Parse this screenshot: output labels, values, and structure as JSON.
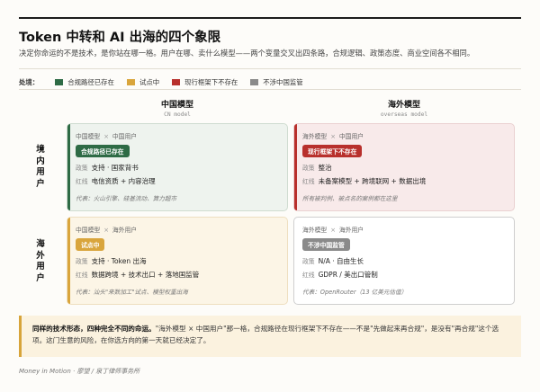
{
  "header": {
    "title": "Token 中转和 AI 出海的四个象限",
    "subtitle": "决定你命运的不是技术，是你站在哪一格。用户在哪、卖什么模型——两个变量交叉出四条路，合规逻辑、政策态度、商业空间各不相同。"
  },
  "legend": {
    "title": "处境：",
    "items": [
      {
        "label": "合规路径已存在",
        "color": "#2e6b45"
      },
      {
        "label": "试点中",
        "color": "#d9a53c"
      },
      {
        "label": "现行框架下不存在",
        "color": "#b8302c"
      },
      {
        "label": "不涉中国监管",
        "color": "#8a8a8a"
      }
    ]
  },
  "columns": [
    {
      "cn": "中国模型",
      "en": "CN model"
    },
    {
      "cn": "海外模型",
      "en": "overseas model"
    }
  ],
  "rows": [
    {
      "label": "境内用户"
    },
    {
      "label": "海外用户"
    }
  ],
  "quadrants": {
    "q1": {
      "model": "中国模型",
      "x": "×",
      "user": "中国用户",
      "badge": "合规路径已存在",
      "badge_color": "#2e6b45",
      "policy_key": "政策",
      "policy": "支持 · 国家背书",
      "red_key": "红线",
      "red": "电信资质 + 内容治理",
      "note": "代表：火山引擎、硅基流动、算力超市"
    },
    "q2": {
      "model": "海外模型",
      "x": "×",
      "user": "中国用户",
      "badge": "现行框架下不存在",
      "badge_color": "#b8302c",
      "policy_key": "政策",
      "policy": "整治",
      "red_key": "红线",
      "red": "未备案模型 + 跨境联网 + 数据出境",
      "note": "所有被判例、被点名的案例都在这里"
    },
    "q3": {
      "model": "中国模型",
      "x": "×",
      "user": "海外用户",
      "badge": "试点中",
      "badge_color": "#d9a53c",
      "policy_key": "政策",
      "policy": "支持 · Token 出海",
      "red_key": "红线",
      "red": "数据跨境 + 技术出口 + 落地国监管",
      "note": "代表：汕头\"来数加工\"试点、模型权重出海"
    },
    "q4": {
      "model": "海外模型",
      "x": "×",
      "user": "海外用户",
      "badge": "不涉中国监管",
      "badge_color": "#8a8a8a",
      "policy_key": "政策",
      "policy": "N/A · 自由生长",
      "red_key": "红线",
      "red": "GDPR / 美出口管制",
      "note": "代表：OpenRouter（13 亿美元估值）"
    }
  },
  "callout": {
    "bold": "同样的技术形态，四种完全不同的命运。",
    "text": "\"海外模型 × 中国用户\"那一格，合规路径在现行框架下不存在——不是\"先做起来再合规\"，是没有\"再合规\"这个选项。这门生意的风险，在你选方向的第一天就已经决定了。"
  },
  "footer": "Money in Motion · 廖望 / 泉丁律师事务所"
}
